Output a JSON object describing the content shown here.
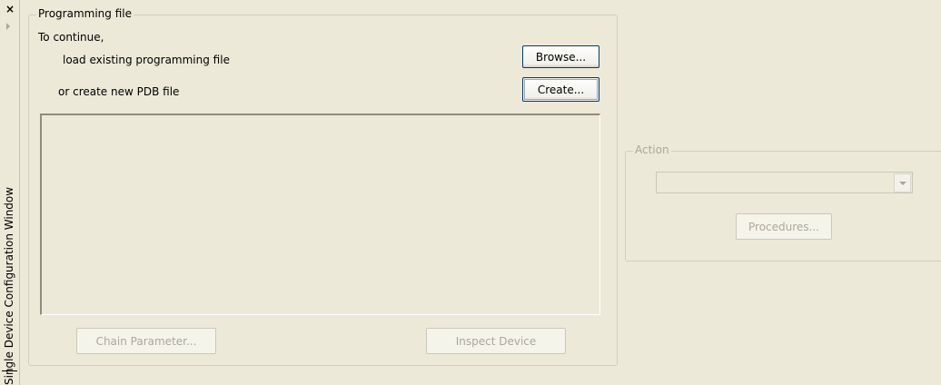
{
  "side_panel": {
    "title": "Single Device Configuration Window",
    "close_glyph": "×"
  },
  "programming_file": {
    "legend": "Programming file",
    "prompt": "To continue,",
    "load_label": "load existing programming file",
    "browse_button": "Browse...",
    "create_label": "or create new PDB file",
    "create_button": "Create...",
    "chain_parameter_button": "Chain Parameter...",
    "inspect_device_button": "Inspect Device"
  },
  "action": {
    "legend": "Action",
    "selected_value": "",
    "procedures_button": "Procedures..."
  },
  "colors": {
    "background": "#ece9d8",
    "disabled_text": "#aca899",
    "button_border": "#003c74"
  }
}
